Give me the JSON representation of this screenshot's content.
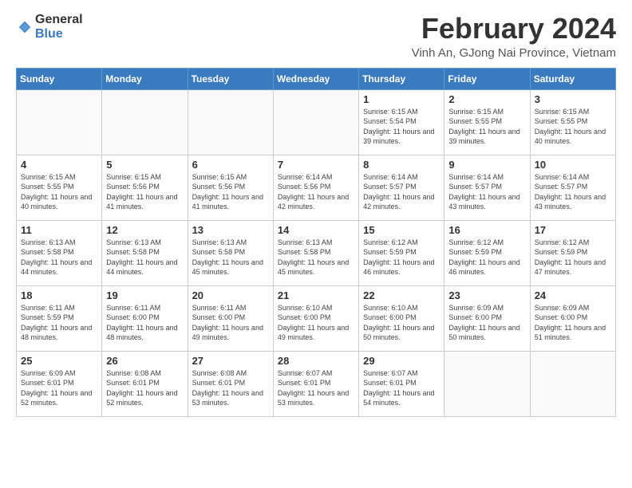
{
  "logo": {
    "general": "General",
    "blue": "Blue"
  },
  "header": {
    "month_year": "February 2024",
    "location": "Vinh An, GJong Nai Province, Vietnam"
  },
  "weekdays": [
    "Sunday",
    "Monday",
    "Tuesday",
    "Wednesday",
    "Thursday",
    "Friday",
    "Saturday"
  ],
  "weeks": [
    [
      {
        "day": "",
        "info": ""
      },
      {
        "day": "",
        "info": ""
      },
      {
        "day": "",
        "info": ""
      },
      {
        "day": "",
        "info": ""
      },
      {
        "day": "1",
        "info": "Sunrise: 6:15 AM\nSunset: 5:54 PM\nDaylight: 11 hours and 39 minutes."
      },
      {
        "day": "2",
        "info": "Sunrise: 6:15 AM\nSunset: 5:55 PM\nDaylight: 11 hours and 39 minutes."
      },
      {
        "day": "3",
        "info": "Sunrise: 6:15 AM\nSunset: 5:55 PM\nDaylight: 11 hours and 40 minutes."
      }
    ],
    [
      {
        "day": "4",
        "info": "Sunrise: 6:15 AM\nSunset: 5:55 PM\nDaylight: 11 hours and 40 minutes."
      },
      {
        "day": "5",
        "info": "Sunrise: 6:15 AM\nSunset: 5:56 PM\nDaylight: 11 hours and 41 minutes."
      },
      {
        "day": "6",
        "info": "Sunrise: 6:15 AM\nSunset: 5:56 PM\nDaylight: 11 hours and 41 minutes."
      },
      {
        "day": "7",
        "info": "Sunrise: 6:14 AM\nSunset: 5:56 PM\nDaylight: 11 hours and 42 minutes."
      },
      {
        "day": "8",
        "info": "Sunrise: 6:14 AM\nSunset: 5:57 PM\nDaylight: 11 hours and 42 minutes."
      },
      {
        "day": "9",
        "info": "Sunrise: 6:14 AM\nSunset: 5:57 PM\nDaylight: 11 hours and 43 minutes."
      },
      {
        "day": "10",
        "info": "Sunrise: 6:14 AM\nSunset: 5:57 PM\nDaylight: 11 hours and 43 minutes."
      }
    ],
    [
      {
        "day": "11",
        "info": "Sunrise: 6:13 AM\nSunset: 5:58 PM\nDaylight: 11 hours and 44 minutes."
      },
      {
        "day": "12",
        "info": "Sunrise: 6:13 AM\nSunset: 5:58 PM\nDaylight: 11 hours and 44 minutes."
      },
      {
        "day": "13",
        "info": "Sunrise: 6:13 AM\nSunset: 5:58 PM\nDaylight: 11 hours and 45 minutes."
      },
      {
        "day": "14",
        "info": "Sunrise: 6:13 AM\nSunset: 5:58 PM\nDaylight: 11 hours and 45 minutes."
      },
      {
        "day": "15",
        "info": "Sunrise: 6:12 AM\nSunset: 5:59 PM\nDaylight: 11 hours and 46 minutes."
      },
      {
        "day": "16",
        "info": "Sunrise: 6:12 AM\nSunset: 5:59 PM\nDaylight: 11 hours and 46 minutes."
      },
      {
        "day": "17",
        "info": "Sunrise: 6:12 AM\nSunset: 5:59 PM\nDaylight: 11 hours and 47 minutes."
      }
    ],
    [
      {
        "day": "18",
        "info": "Sunrise: 6:11 AM\nSunset: 5:59 PM\nDaylight: 11 hours and 48 minutes."
      },
      {
        "day": "19",
        "info": "Sunrise: 6:11 AM\nSunset: 6:00 PM\nDaylight: 11 hours and 48 minutes."
      },
      {
        "day": "20",
        "info": "Sunrise: 6:11 AM\nSunset: 6:00 PM\nDaylight: 11 hours and 49 minutes."
      },
      {
        "day": "21",
        "info": "Sunrise: 6:10 AM\nSunset: 6:00 PM\nDaylight: 11 hours and 49 minutes."
      },
      {
        "day": "22",
        "info": "Sunrise: 6:10 AM\nSunset: 6:00 PM\nDaylight: 11 hours and 50 minutes."
      },
      {
        "day": "23",
        "info": "Sunrise: 6:09 AM\nSunset: 6:00 PM\nDaylight: 11 hours and 50 minutes."
      },
      {
        "day": "24",
        "info": "Sunrise: 6:09 AM\nSunset: 6:00 PM\nDaylight: 11 hours and 51 minutes."
      }
    ],
    [
      {
        "day": "25",
        "info": "Sunrise: 6:09 AM\nSunset: 6:01 PM\nDaylight: 11 hours and 52 minutes."
      },
      {
        "day": "26",
        "info": "Sunrise: 6:08 AM\nSunset: 6:01 PM\nDaylight: 11 hours and 52 minutes."
      },
      {
        "day": "27",
        "info": "Sunrise: 6:08 AM\nSunset: 6:01 PM\nDaylight: 11 hours and 53 minutes."
      },
      {
        "day": "28",
        "info": "Sunrise: 6:07 AM\nSunset: 6:01 PM\nDaylight: 11 hours and 53 minutes."
      },
      {
        "day": "29",
        "info": "Sunrise: 6:07 AM\nSunset: 6:01 PM\nDaylight: 11 hours and 54 minutes."
      },
      {
        "day": "",
        "info": ""
      },
      {
        "day": "",
        "info": ""
      }
    ]
  ]
}
